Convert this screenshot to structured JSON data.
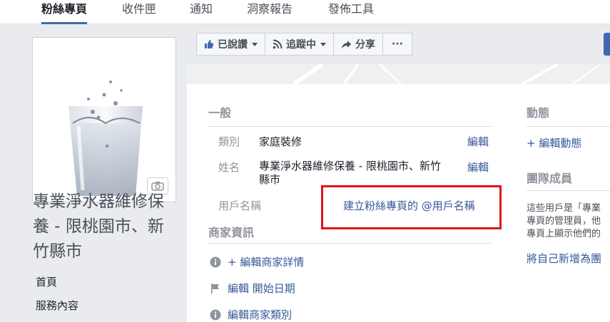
{
  "tabs": [
    "粉絲專頁",
    "收件匣",
    "通知",
    "洞察報告",
    "發佈工具"
  ],
  "page": {
    "name": "專業淨水器維修保養 - 限桃園市、新竹縣市",
    "nav": [
      "首頁",
      "服務內容"
    ]
  },
  "actions": {
    "liked": "已說讚",
    "following": "追蹤中",
    "share": "分享",
    "more": "···"
  },
  "general": {
    "title": "一般",
    "category_label": "類別",
    "category_value": "家庭裝修",
    "name_label": "姓名",
    "name_value_line1": "專業淨水器維修保養 - 限桃園市、新竹",
    "name_value_line2": "縣市",
    "username_label": "用戶名稱",
    "username_link": "建立粉絲專頁的 @用戶名稱",
    "edit": "編輯"
  },
  "business": {
    "title": "商家資訊",
    "edit_details": "+ 編輯商家詳情",
    "start_date": "編輯 開始日期",
    "category": "編輯商家類別"
  },
  "right": {
    "activity_title": "動態",
    "edit_activity": "+ 編輯動態",
    "team_title": "團隊成員",
    "team_desc_1": "這些用戶是「專業",
    "team_desc_2": "專頁的管理員，他",
    "team_desc_3": "專頁上顯示他們的",
    "add_self": "將自己新增為團"
  },
  "colors": {
    "link": "#365899",
    "accent": "#4267b2",
    "highlight": "#e0141b"
  }
}
